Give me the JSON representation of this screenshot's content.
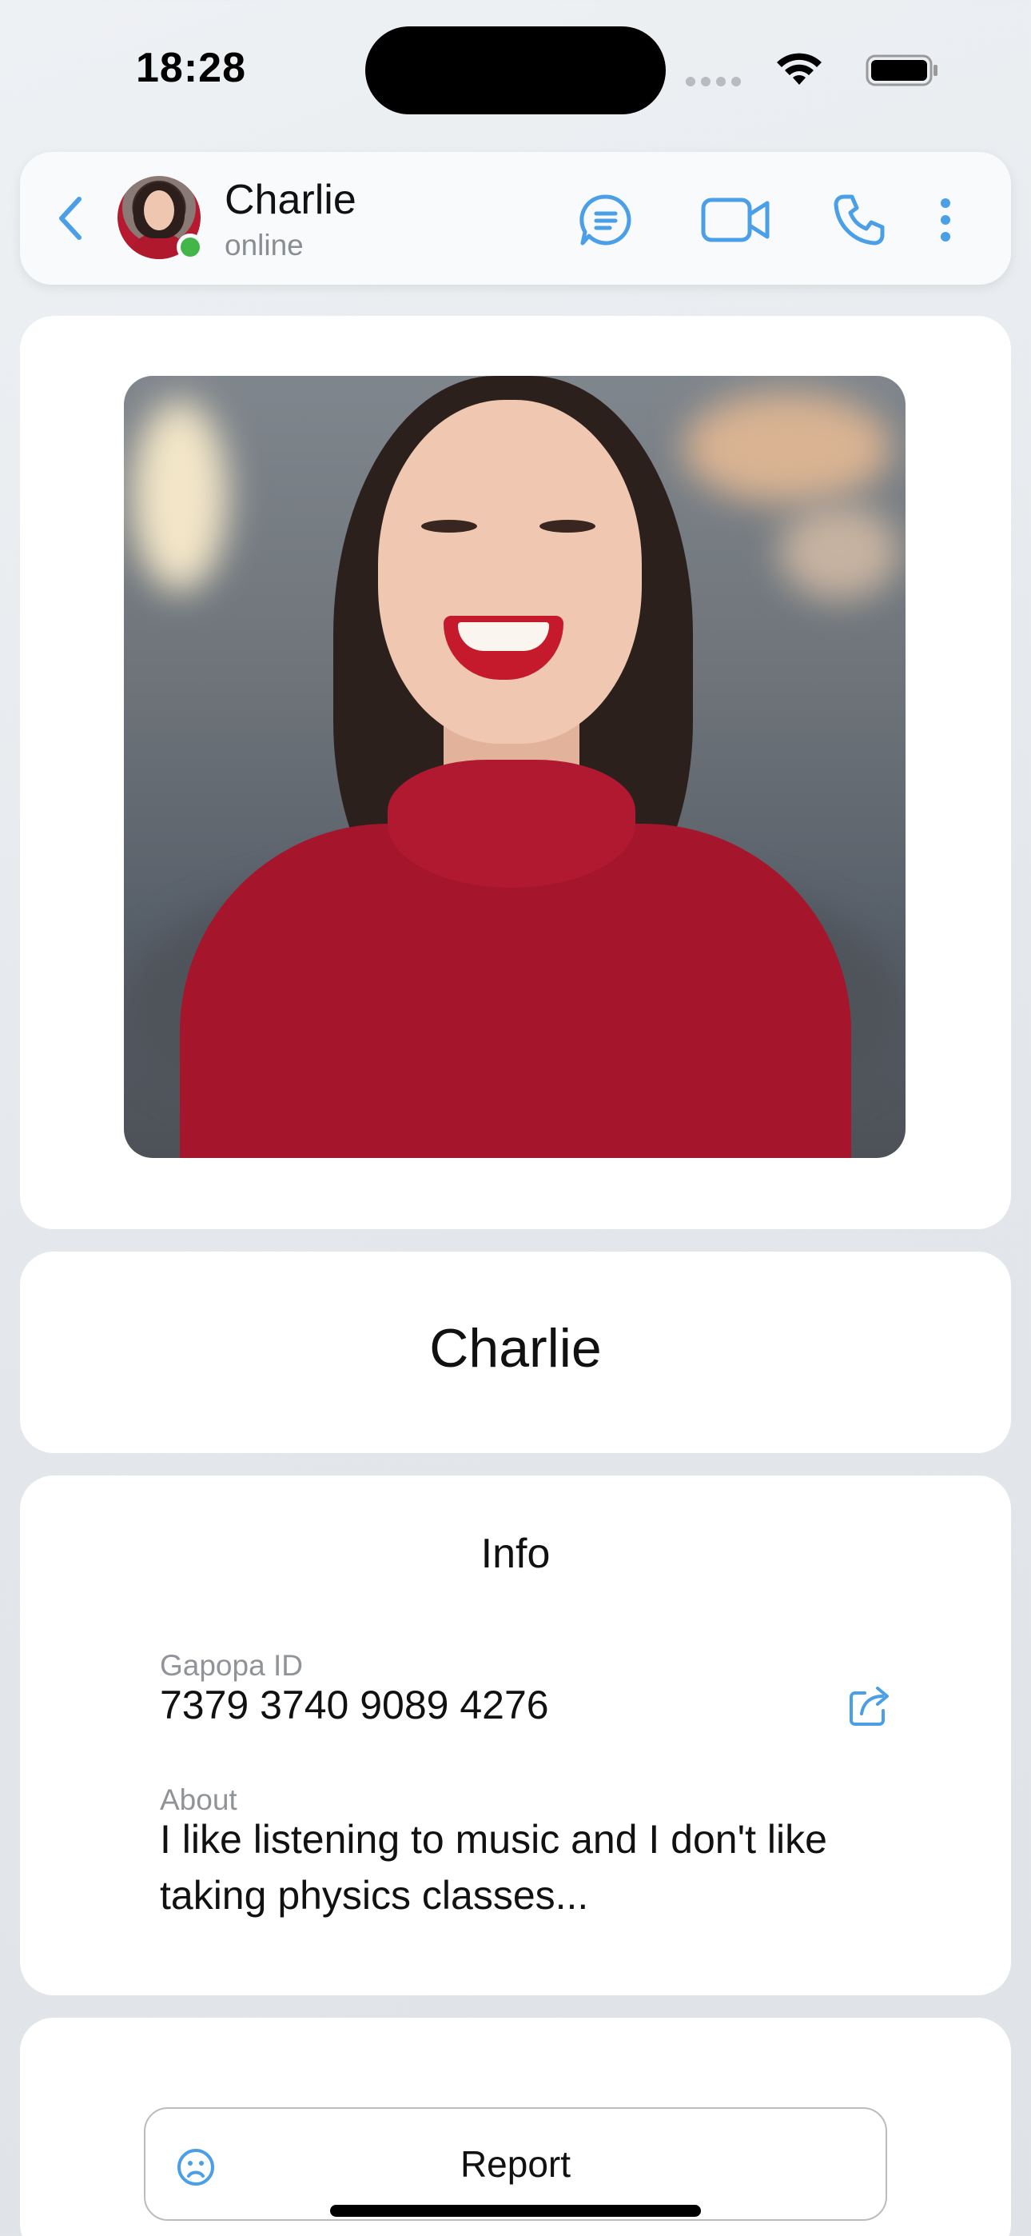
{
  "status_bar": {
    "time": "18:28"
  },
  "header": {
    "name": "Charlie",
    "status": "online"
  },
  "profile": {
    "display_name": "Charlie"
  },
  "info": {
    "title": "Info",
    "id_label": "Gapopa ID",
    "id_value": "7379 3740 9089 4276",
    "about_label": "About",
    "about_value": "I like listening to music and I don't like taking physics classes..."
  },
  "actions": {
    "report_label": "Report"
  },
  "colors": {
    "accent": "#4a9fe6",
    "online": "#42b649",
    "card": "#ffffff",
    "background": "#e6e9ed"
  },
  "icons": {
    "back": "chevron-left-icon",
    "chat": "chat-bubble-icon",
    "video": "video-camera-icon",
    "call": "phone-icon",
    "more": "more-vertical-icon",
    "share": "share-icon",
    "report": "sad-face-icon"
  }
}
